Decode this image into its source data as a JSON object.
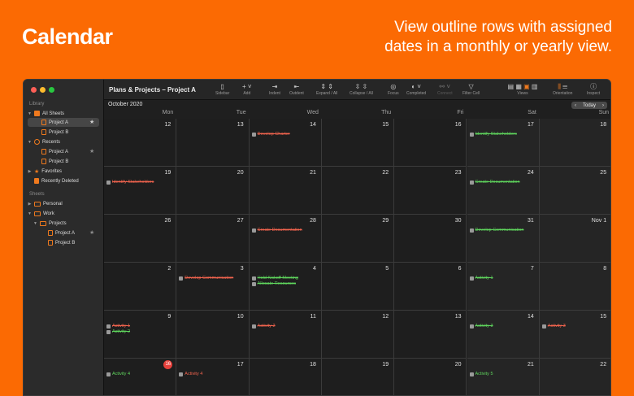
{
  "hero": {
    "title": "Calendar",
    "tagline": "View outline rows with assigned dates in a monthly or yearly view."
  },
  "colors": {
    "background": "#fb6a03",
    "accent": "#f07a1e",
    "green": "#5fd65d",
    "red": "#f2644e",
    "today": "#e8413c"
  },
  "window": {
    "title": "Plans & Projects – Project A"
  },
  "sidebar": {
    "library_label": "Library",
    "all_sheets": "All Sheets",
    "project_a": "Project A",
    "project_b": "Project B",
    "recents": "Recents",
    "recents_a": "Project A",
    "recents_b": "Project B",
    "favorites": "Favorites",
    "recently_deleted": "Recently Deleted",
    "sheets_label": "Sheets",
    "personal": "Personal",
    "work": "Work",
    "projects": "Projects",
    "work_a": "Project A",
    "work_b": "Project B"
  },
  "toolbar": {
    "sidebar": "Sidebar",
    "add": "Add",
    "indent": "Indent",
    "outdent": "Outdent",
    "expand": "Expand / All",
    "collapse": "Collapse / All",
    "focus": "Focus",
    "completed": "Completed",
    "connect": "Connect",
    "filter": "Filter Cell",
    "views": "Views",
    "orientation": "Orientation",
    "inspect": "Inspect"
  },
  "calendar": {
    "month": "October 2020",
    "today_label": "Today",
    "prev": "‹",
    "next": "›",
    "days": [
      "Mon",
      "Tue",
      "Wed",
      "Thu",
      "Fri",
      "Sat",
      "Sun"
    ],
    "weeks": [
      [
        {
          "d": "12",
          "events": []
        },
        {
          "d": "13",
          "events": []
        },
        {
          "d": "14",
          "events": [
            {
              "t": "Develop Charter",
              "c": "red",
              "done": true
            }
          ]
        },
        {
          "d": "15",
          "events": []
        },
        {
          "d": "16",
          "events": []
        },
        {
          "d": "17",
          "events": [
            {
              "t": "Identify Stakeholders",
              "c": "green",
              "done": true
            }
          ]
        },
        {
          "d": "18",
          "events": []
        }
      ],
      [
        {
          "d": "19",
          "events": [
            {
              "t": "Identify Stakeholders",
              "c": "red",
              "done": true
            }
          ]
        },
        {
          "d": "20",
          "events": []
        },
        {
          "d": "21",
          "events": []
        },
        {
          "d": "22",
          "events": []
        },
        {
          "d": "23",
          "events": []
        },
        {
          "d": "24",
          "events": [
            {
              "t": "Create Documentation",
              "c": "green",
              "done": true
            }
          ]
        },
        {
          "d": "25",
          "events": []
        }
      ],
      [
        {
          "d": "26",
          "events": []
        },
        {
          "d": "27",
          "events": []
        },
        {
          "d": "28",
          "events": [
            {
              "t": "Create Documentation",
              "c": "red",
              "done": true
            }
          ]
        },
        {
          "d": "29",
          "events": []
        },
        {
          "d": "30",
          "events": []
        },
        {
          "d": "31",
          "events": [
            {
              "t": "Develop Communication",
              "c": "green",
              "done": true
            }
          ]
        },
        {
          "d": "Nov 1",
          "events": []
        }
      ],
      [
        {
          "d": "2",
          "events": []
        },
        {
          "d": "3",
          "events": [
            {
              "t": "Develop Communication",
              "c": "red",
              "done": true
            }
          ]
        },
        {
          "d": "4",
          "events": [
            {
              "t": "Hold Kickoff Meeting",
              "c": "green",
              "done": true
            },
            {
              "t": "Allocate Resources",
              "c": "green",
              "done": true
            }
          ]
        },
        {
          "d": "5",
          "events": []
        },
        {
          "d": "6",
          "events": []
        },
        {
          "d": "7",
          "events": [
            {
              "t": "Activity 1",
              "c": "green",
              "done": true
            }
          ]
        },
        {
          "d": "8",
          "events": []
        }
      ],
      [
        {
          "d": "9",
          "events": [
            {
              "t": "Activity 1",
              "c": "red",
              "done": true
            },
            {
              "t": "Activity 2",
              "c": "green",
              "done": true
            }
          ]
        },
        {
          "d": "10",
          "events": []
        },
        {
          "d": "11",
          "events": [
            {
              "t": "Activity 2",
              "c": "red",
              "done": true
            }
          ]
        },
        {
          "d": "12",
          "events": []
        },
        {
          "d": "13",
          "events": []
        },
        {
          "d": "14",
          "events": [
            {
              "t": "Activity 3",
              "c": "green",
              "done": true
            }
          ]
        },
        {
          "d": "15",
          "events": [
            {
              "t": "Activity 3",
              "c": "red",
              "done": true
            }
          ]
        }
      ],
      [
        {
          "d": "16",
          "events": [
            {
              "t": "Activity 4",
              "c": "green",
              "done": false
            }
          ]
        },
        {
          "d": "17",
          "events": [
            {
              "t": "Activity 4",
              "c": "red",
              "done": false
            }
          ]
        },
        {
          "d": "18",
          "events": []
        },
        {
          "d": "19",
          "events": []
        },
        {
          "d": "20",
          "events": []
        },
        {
          "d": "21",
          "events": [
            {
              "t": "Activity 5",
              "c": "green",
              "done": false
            }
          ]
        },
        {
          "d": "22",
          "events": []
        }
      ]
    ]
  }
}
